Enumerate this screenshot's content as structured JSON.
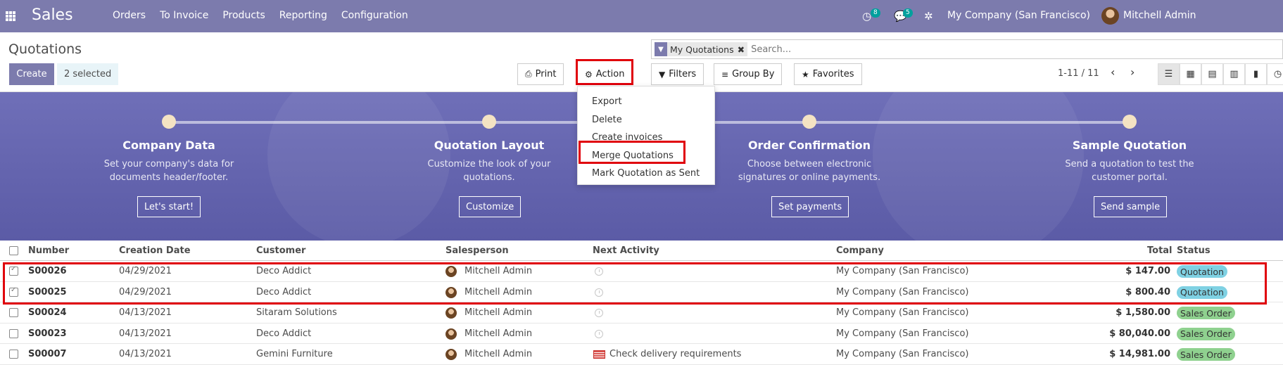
{
  "app": {
    "name": "Sales",
    "menu": [
      "Orders",
      "To Invoice",
      "Products",
      "Reporting",
      "Configuration"
    ],
    "activity_count": "8",
    "message_count": "5",
    "company": "My Company (San Francisco)",
    "user": "Mitchell Admin"
  },
  "control_panel": {
    "breadcrumb": "Quotations",
    "create_label": "Create",
    "selected_label": "2 selected",
    "print_label": "Print",
    "action_label": "Action",
    "filters_label": "Filters",
    "groupby_label": "Group By",
    "favorites_label": "Favorites",
    "facet_label": "My Quotations",
    "search_placeholder": "Search...",
    "pager": "1-11 / 11"
  },
  "action_menu": {
    "items": [
      "Export",
      "Delete",
      "Create invoices",
      "Merge Quotations",
      "Mark Quotation as Sent"
    ]
  },
  "onboarding": {
    "steps": [
      {
        "title": "Company Data",
        "desc1": "Set your company's data for",
        "desc2": "documents header/footer.",
        "button": "Let's start!"
      },
      {
        "title": "Quotation Layout",
        "desc1": "Customize the look of your",
        "desc2": "quotations.",
        "button": "Customize"
      },
      {
        "title": "Order Confirmation",
        "desc1": "Choose between electronic",
        "desc2": "signatures or online payments.",
        "button": "Set payments"
      },
      {
        "title": "Sample Quotation",
        "desc1": "Send a quotation to test the",
        "desc2": "customer portal.",
        "button": "Send sample"
      }
    ]
  },
  "table": {
    "headers": {
      "number": "Number",
      "creation_date": "Creation Date",
      "customer": "Customer",
      "salesperson": "Salesperson",
      "next_activity": "Next Activity",
      "company": "Company",
      "total": "Total",
      "status": "Status"
    },
    "rows": [
      {
        "number": "S00026",
        "date": "04/29/2021",
        "customer": "Deco Addict",
        "salesperson": "Mitchell Admin",
        "activity": "",
        "company": "My Company (San Francisco)",
        "total": "$ 147.00",
        "status": "Quotation",
        "checked": true
      },
      {
        "number": "S00025",
        "date": "04/29/2021",
        "customer": "Deco Addict",
        "salesperson": "Mitchell Admin",
        "activity": "",
        "company": "My Company (San Francisco)",
        "total": "$ 800.40",
        "status": "Quotation",
        "checked": true
      },
      {
        "number": "S00024",
        "date": "04/13/2021",
        "customer": "Sitaram Solutions",
        "salesperson": "Mitchell Admin",
        "activity": "",
        "company": "My Company (San Francisco)",
        "total": "$ 1,580.00",
        "status": "Sales Order",
        "checked": false
      },
      {
        "number": "S00023",
        "date": "04/13/2021",
        "customer": "Deco Addict",
        "salesperson": "Mitchell Admin",
        "activity": "",
        "company": "My Company (San Francisco)",
        "total": "$ 80,040.00",
        "status": "Sales Order",
        "checked": false
      },
      {
        "number": "S00007",
        "date": "04/13/2021",
        "customer": "Gemini Furniture",
        "salesperson": "Mitchell Admin",
        "activity": "Check delivery requirements",
        "company": "My Company (San Francisco)",
        "total": "$ 14,981.00",
        "status": "Sales Order",
        "checked": false
      }
    ]
  },
  "colors": {
    "brand": "#7c7bad",
    "highlight": "#e0000b",
    "quotation_badge": "#7fd1e3",
    "sales_order_badge": "#8fd18f"
  }
}
